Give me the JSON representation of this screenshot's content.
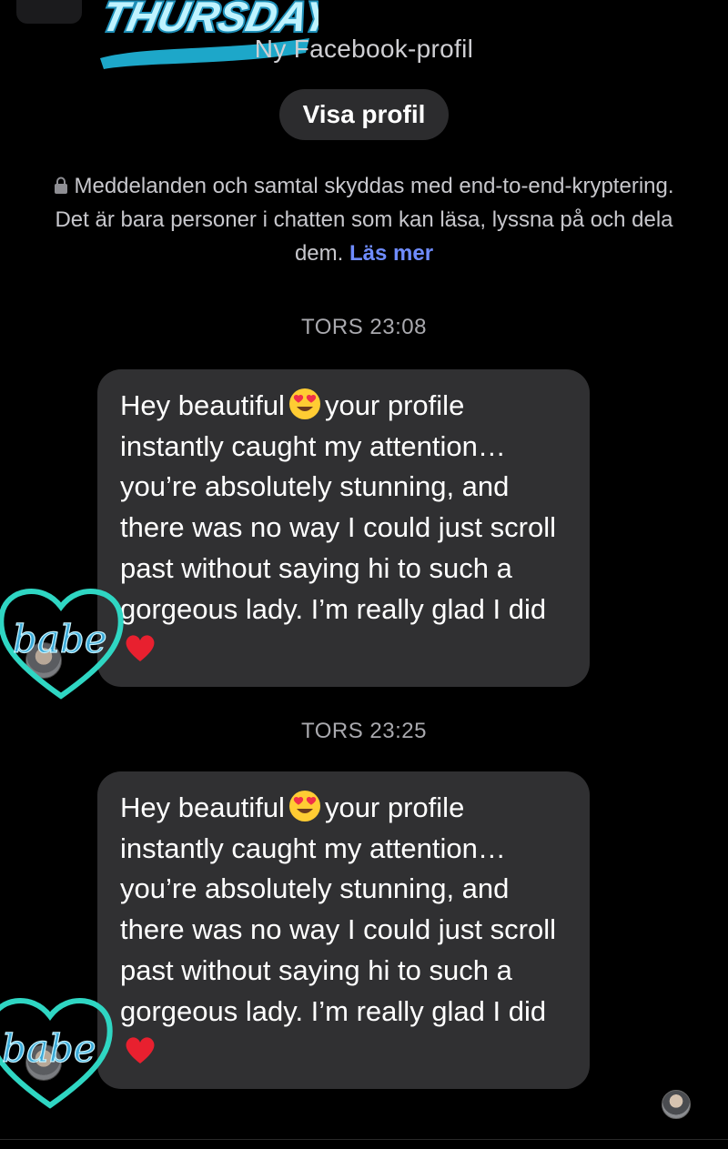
{
  "header": {
    "subtitle": "Ny Facebook-profil",
    "view_profile_label": "Visa profil",
    "sticker_text": "THURSDAY"
  },
  "encryption_notice": {
    "text": "Meddelanden och samtal skyddas med end-to-end-kryptering. Det är bara personer i chatten som kan läsa, lyssna på och dela dem.",
    "link_label": "Läs mer"
  },
  "messages": [
    {
      "timestamp": "TORS 23:08",
      "text_before_emoji": "Hey beautiful",
      "emoji_1": "heart-eyes",
      "text_after_emoji": "your profile instantly caught my attention… you’re absolutely stunning, and there was no way I could just scroll past without saying hi to such a gorgeous lady. I’m really glad I did",
      "emoji_2": "red-heart"
    },
    {
      "timestamp": "TORS 23:25",
      "text_before_emoji": "Hey beautiful",
      "emoji_1": "heart-eyes",
      "text_after_emoji": "your profile instantly caught my attention… you’re absolutely stunning, and there was no way I could just scroll past without saying hi to such a gorgeous lady. I’m really glad I did",
      "emoji_2": "red-heart"
    }
  ],
  "stickers": {
    "babe_text": "babe"
  },
  "colors": {
    "background": "#000000",
    "bubble": "#303032",
    "link": "#6f8cff",
    "sticker_teal": "#2fd6c3",
    "sticker_blue": "#3aa9d8"
  }
}
